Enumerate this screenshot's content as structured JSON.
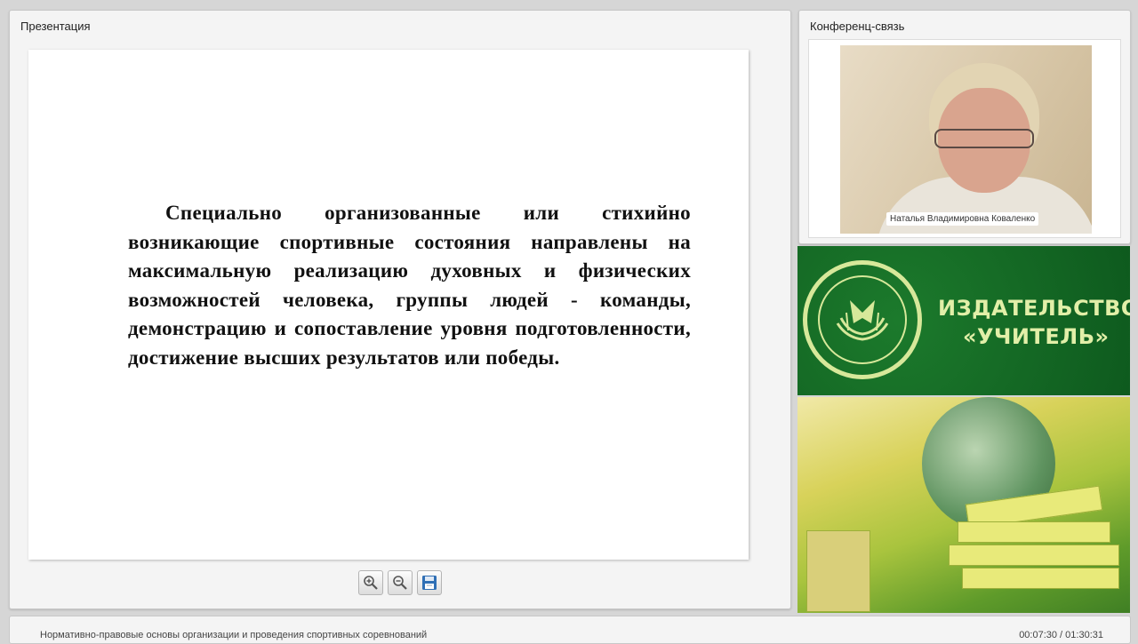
{
  "presentation": {
    "title": "Презентация",
    "slide_text": "Специально организованные или стихийно возникающие спортивные состояния направлены на максимальную реализацию духовных и физических возможностей человека, группы людей - команды, демонстрацию и сопоставление уровня подготовленности, достижение высших результатов или победы."
  },
  "toolbar": {
    "buttons": [
      {
        "icon": "zoom-in-icon"
      },
      {
        "icon": "zoom-out-icon"
      },
      {
        "icon": "save-icon"
      }
    ]
  },
  "conference": {
    "title": "Конференц-связь",
    "speaker_name": "Наталья Владимировна Коваленко"
  },
  "ad": {
    "publisher_line1": "ИЗДАТЕЛЬСТВО",
    "publisher_line2": "«УЧИТЕЛЬ»",
    "brand_green": "#0e5a1e",
    "text_color": "#e2efa8"
  },
  "footer": {
    "course_title": "Нормативно-правовые основы организации и проведения спортивных соревнований",
    "timecode": "00:07:30 / 01:30:31"
  }
}
